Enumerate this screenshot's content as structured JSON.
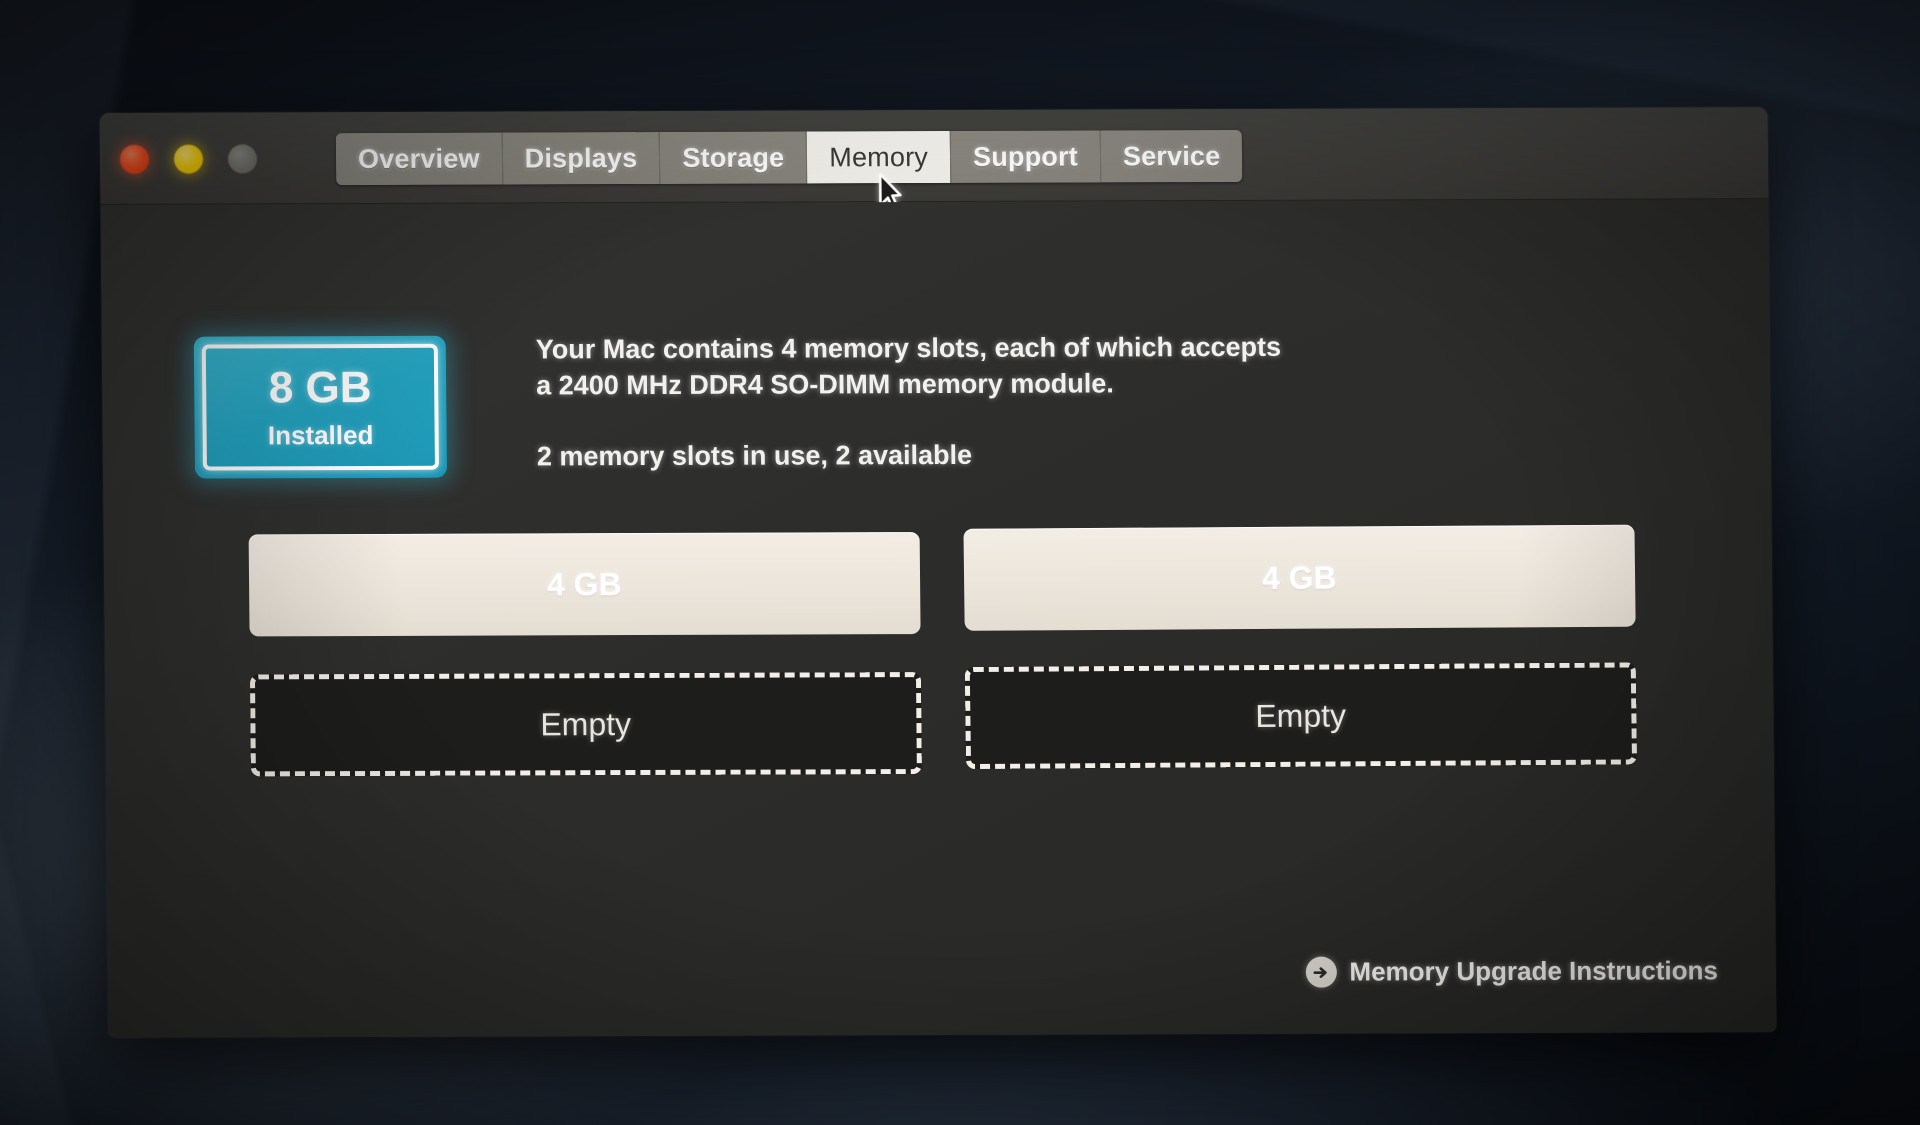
{
  "window": {
    "traffic_lights": [
      {
        "name": "close",
        "color": "#fb4f22",
        "enabled": true
      },
      {
        "name": "minimize",
        "color": "#ffd60a",
        "enabled": true
      },
      {
        "name": "zoom",
        "color": "#76766f",
        "enabled": false
      }
    ]
  },
  "tabs": [
    {
      "label": "Overview",
      "selected": false
    },
    {
      "label": "Displays",
      "selected": false
    },
    {
      "label": "Storage",
      "selected": false
    },
    {
      "label": "Memory",
      "selected": true
    },
    {
      "label": "Support",
      "selected": false
    },
    {
      "label": "Service",
      "selected": false
    }
  ],
  "memory": {
    "badge": {
      "amount": "8 GB",
      "caption": "Installed",
      "accent_color": "#23a2bf"
    },
    "description_line1": "Your Mac contains 4 memory slots, each of which accepts",
    "description_line2": "a 2400 MHz DDR4 SO-DIMM memory module.",
    "slots_summary": "2 memory slots in use, 2 available",
    "slot_count": 4,
    "slots_in_use": 2,
    "slots_available": 2,
    "slots": [
      {
        "label": "4 GB",
        "state": "filled"
      },
      {
        "label": "4 GB",
        "state": "filled"
      },
      {
        "label": "Empty",
        "state": "empty"
      },
      {
        "label": "Empty",
        "state": "empty"
      }
    ],
    "upgrade_link": {
      "label": "Memory Upgrade Instructions",
      "icon": "arrow-right-circle-icon"
    }
  },
  "cursor": {
    "icon": "arrow-pointer-icon"
  }
}
